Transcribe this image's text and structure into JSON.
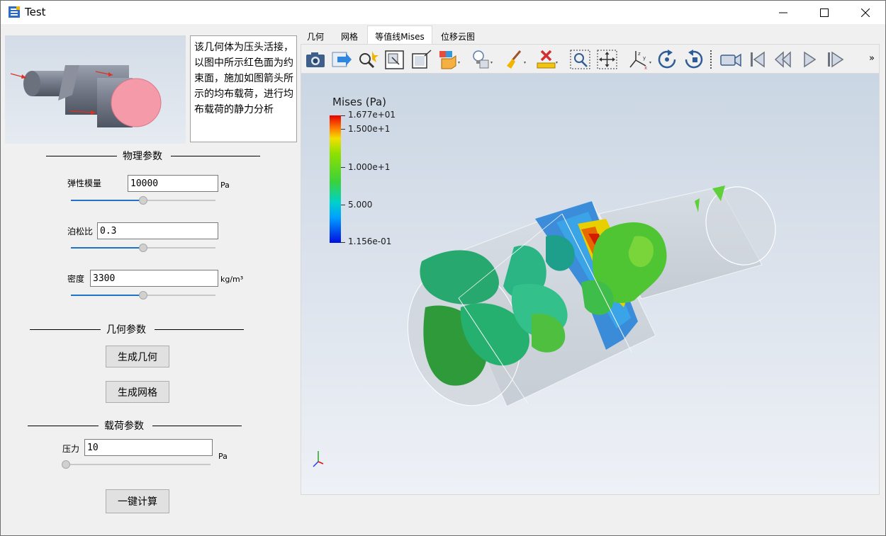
{
  "window": {
    "title": "Test"
  },
  "left_panel": {
    "description": "该几何体为压头活接，以图中所示红色面为约束面，施加如图箭头所示的均布载荷，进行均布载荷的静力分析",
    "physics_section": "物理参数",
    "elastic_modulus": {
      "label": "弹性模量",
      "value": "10000",
      "unit": "Pa",
      "slider_fraction": 0.5
    },
    "poisson_ratio": {
      "label": "泊松比",
      "value": "0.3",
      "slider_fraction": 0.5
    },
    "density": {
      "label": "密度",
      "value": "3300",
      "unit": "kg/m³",
      "slider_fraction": 0.5
    },
    "geometry_section": "几何参数",
    "generate_geometry_button": "生成几何",
    "generate_mesh_button": "生成网格",
    "load_section": "载荷参数",
    "pressure": {
      "label": "压力",
      "value": "10",
      "unit": "Pa",
      "slider_fraction": 0.0
    },
    "compute_button": "一键计算"
  },
  "tabs": [
    "几何",
    "网格",
    "等值线Mises",
    "位移云图"
  ],
  "active_tab": "等值线Mises",
  "toolbar": {
    "icons": [
      "camera-icon",
      "export-icon",
      "magic-select-icon",
      "fit-box-icon",
      "resize-icon",
      "color-cube-icon",
      "lightbulb-icon",
      "paint-brush-icon",
      "ruler-delete-icon",
      "zoom-window-icon",
      "pan-icon",
      "axes-icon",
      "rotate-cw-icon",
      "rotate-ccw-icon",
      "video-camera-icon",
      "skip-first-icon",
      "previous-icon",
      "play-icon",
      "skip-last-icon"
    ],
    "overflow_label": "»"
  },
  "legend": {
    "title": "Mises (Pa)",
    "labels": [
      "1.677e+01",
      "1.500e+1",
      "1.000e+1",
      "5.000",
      "1.156e-01"
    ],
    "colors": {
      "max": "#e60000",
      "mid": "#3ad23a",
      "min": "#0010e0"
    }
  }
}
